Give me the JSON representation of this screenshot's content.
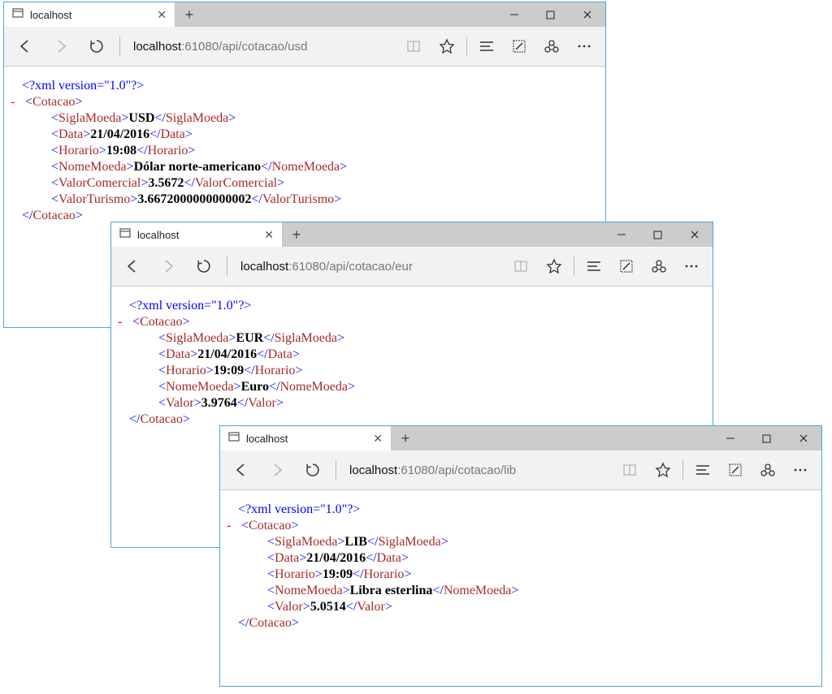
{
  "windows": [
    {
      "tab_title": "localhost",
      "url_host": "localhost",
      "url_path": ":61080/api/cotacao/usd",
      "xml_decl": "<?xml version=\"1.0\"?>",
      "root": "Cotacao",
      "fields": [
        {
          "name": "SiglaMoeda",
          "value": "USD"
        },
        {
          "name": "Data",
          "value": "21/04/2016"
        },
        {
          "name": "Horario",
          "value": "19:08"
        },
        {
          "name": "NomeMoeda",
          "value": "Dólar norte-americano"
        },
        {
          "name": "ValorComercial",
          "value": "3.5672"
        },
        {
          "name": "ValorTurismo",
          "value": "3.6672000000000002"
        }
      ]
    },
    {
      "tab_title": "localhost",
      "url_host": "localhost",
      "url_path": ":61080/api/cotacao/eur",
      "xml_decl": "<?xml version=\"1.0\"?>",
      "root": "Cotacao",
      "fields": [
        {
          "name": "SiglaMoeda",
          "value": "EUR"
        },
        {
          "name": "Data",
          "value": "21/04/2016"
        },
        {
          "name": "Horario",
          "value": "19:09"
        },
        {
          "name": "NomeMoeda",
          "value": "Euro"
        },
        {
          "name": "Valor",
          "value": "3.9764"
        }
      ]
    },
    {
      "tab_title": "localhost",
      "url_host": "localhost",
      "url_path": ":61080/api/cotacao/lib",
      "xml_decl": "<?xml version=\"1.0\"?>",
      "root": "Cotacao",
      "fields": [
        {
          "name": "SiglaMoeda",
          "value": "LIB"
        },
        {
          "name": "Data",
          "value": "21/04/2016"
        },
        {
          "name": "Horario",
          "value": "19:09"
        },
        {
          "name": "NomeMoeda",
          "value": "Libra esterlina"
        },
        {
          "name": "Valor",
          "value": "5.0514"
        }
      ]
    }
  ]
}
